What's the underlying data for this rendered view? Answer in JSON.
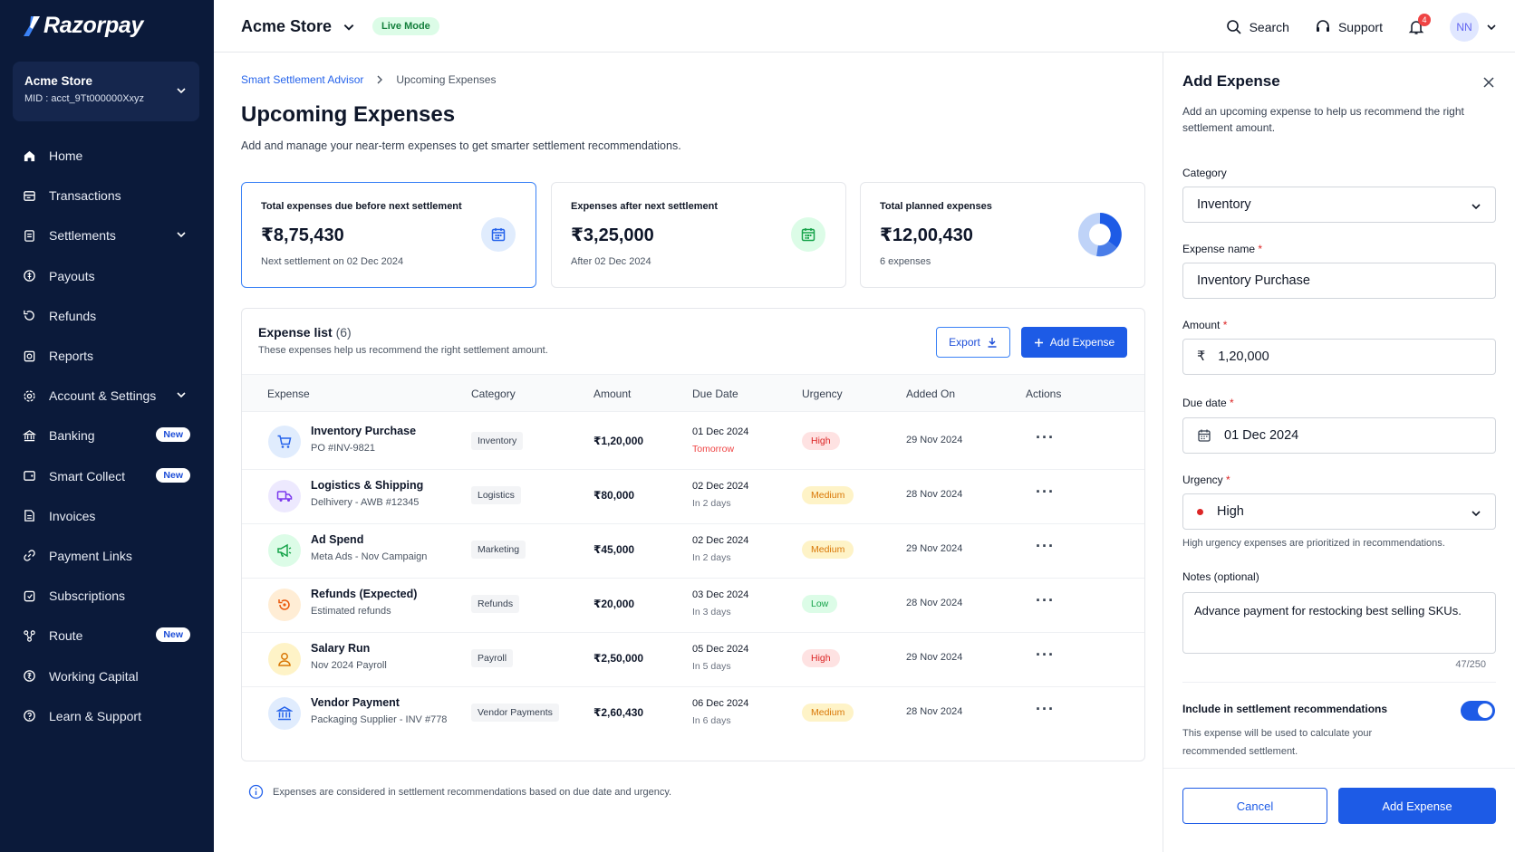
{
  "app": {
    "brand": "Razorpay"
  },
  "sidebar": {
    "store": {
      "name": "Acme Store",
      "mid": "MID : acct_9Tt000000Xxyz"
    },
    "items": [
      {
        "label": "Home",
        "icon": "home-icon"
      },
      {
        "label": "Transactions",
        "icon": "transactions-icon"
      },
      {
        "label": "Settlements",
        "icon": "settlements-icon",
        "expandable": true
      },
      {
        "label": "Payouts",
        "icon": "payouts-icon"
      },
      {
        "label": "Refunds",
        "icon": "refunds-icon"
      },
      {
        "label": "Reports",
        "icon": "reports-icon"
      },
      {
        "label": "Account & Settings",
        "icon": "settings-icon",
        "expandable": true
      },
      {
        "label": "Banking",
        "icon": "bank-icon",
        "badge": "New"
      },
      {
        "label": "Smart Collect",
        "icon": "smart-collect-icon",
        "badge": "New"
      },
      {
        "label": "Invoices",
        "icon": "invoice-icon"
      },
      {
        "label": "Payment Links",
        "icon": "link-icon"
      },
      {
        "label": "Subscriptions",
        "icon": "subscriptions-icon"
      },
      {
        "label": "Route",
        "icon": "route-icon",
        "badge": "New"
      },
      {
        "label": "Working Capital",
        "icon": "capital-icon"
      },
      {
        "label": "Learn & Support",
        "icon": "support-icon"
      }
    ]
  },
  "topbar": {
    "store": "Acme Store",
    "mode": "Live Mode",
    "search": "Search",
    "support": "Support",
    "notifications": "4",
    "avatar": "NN"
  },
  "breadcrumb": {
    "parent": "Smart Settlement Advisor",
    "current": "Upcoming Expenses"
  },
  "page": {
    "title": "Upcoming Expenses",
    "subtitle": "Add and manage your near-term expenses to get smarter settlement recommendations."
  },
  "cards": [
    {
      "label": "Total expenses due before next settlement",
      "value": "₹8,75,430",
      "sub": "Next settlement on 02 Dec 2024",
      "icon": "calendar-icon"
    },
    {
      "label": "Expenses after next settlement",
      "value": "₹3,25,000",
      "sub": "After 02 Dec 2024",
      "icon": "calendar-icon"
    },
    {
      "label": "Total planned expenses",
      "value": "₹12,00,430",
      "sub": "6 expenses",
      "icon": "donut-icon"
    }
  ],
  "expense_list": {
    "title": "Expense list",
    "count": "(6)",
    "subtitle": "These expenses help us recommend the right settlement amount.",
    "export_label": "Export",
    "add_label": "Add Expense",
    "columns": [
      "Expense",
      "Category",
      "Amount",
      "Due Date",
      "Urgency",
      "Added On",
      "Actions"
    ],
    "rows": [
      {
        "name": "Inventory Purchase",
        "sub": "PO #INV-9821",
        "category": "Inventory",
        "amount": "₹1,20,000",
        "due": "01 Dec 2024",
        "relative": "Tomorrow",
        "urgency": "High",
        "added": "29 Nov 2024",
        "icon": "cart-icon",
        "actions": "···"
      },
      {
        "name": "Logistics & Shipping",
        "sub": "Delhivery - AWB #12345",
        "category": "Logistics",
        "amount": "₹80,000",
        "due": "02 Dec 2024",
        "relative": "In 2 days",
        "urgency": "Medium",
        "added": "28 Nov 2024",
        "icon": "truck-icon",
        "actions": "···"
      },
      {
        "name": "Ad Spend",
        "sub": "Meta Ads - Nov Campaign",
        "category": "Marketing",
        "amount": "₹45,000",
        "due": "02 Dec 2024",
        "relative": "In 2 days",
        "urgency": "Medium",
        "added": "29 Nov 2024",
        "icon": "megaphone-icon",
        "actions": "···"
      },
      {
        "name": "Refunds (Expected)",
        "sub": "Estimated refunds",
        "category": "Refunds",
        "amount": "₹20,000",
        "due": "03 Dec 2024",
        "relative": "In 3 days",
        "urgency": "Low",
        "added": "28 Nov 2024",
        "icon": "refund-icon",
        "actions": "···"
      },
      {
        "name": "Salary Run",
        "sub": "Nov 2024 Payroll",
        "category": "Payroll",
        "amount": "₹2,50,000",
        "due": "05 Dec 2024",
        "relative": "In 5 days",
        "urgency": "High",
        "added": "29 Nov 2024",
        "icon": "person-icon",
        "actions": "···"
      },
      {
        "name": "Vendor Payment",
        "sub": "Packaging Supplier - INV #778",
        "category": "Vendor Payments",
        "amount": "₹2,60,430",
        "due": "06 Dec 2024",
        "relative": "In 6 days",
        "urgency": "Medium",
        "added": "28 Nov 2024",
        "icon": "building-icon",
        "actions": "···"
      }
    ]
  },
  "footnote": "Expenses are considered in settlement recommendations based on due date and urgency.",
  "panel": {
    "title": "Add Expense",
    "description": "Add an upcoming expense to help us recommend the right settlement amount.",
    "category_label": "Category",
    "category_value": "Inventory",
    "name_label": "Expense name",
    "name_value": "Inventory Purchase",
    "amount_label": "Amount",
    "currency": "₹",
    "amount_value": "1,20,000",
    "due_label": "Due date",
    "due_value": "01 Dec 2024",
    "urgency_label": "Urgency",
    "urgency_value": "High",
    "urgency_hint": "High urgency expenses are prioritized in recommendations.",
    "notes_label": "Notes (optional)",
    "notes_value": "Advance payment for restocking best selling SKUs.",
    "char_count": "47/250",
    "include_label": "Include in settlement recommendations",
    "include_sub": "This expense will be used to calculate your recommended settlement.",
    "include_on": true,
    "cancel_label": "Cancel",
    "submit_label": "Add Expense",
    "required_mark": "*"
  },
  "colors": {
    "sidebar": "#0b1a3a",
    "primary": "#1d5be6",
    "high": "#dc2626",
    "medium": "#d97706",
    "low": "#16a34a"
  }
}
